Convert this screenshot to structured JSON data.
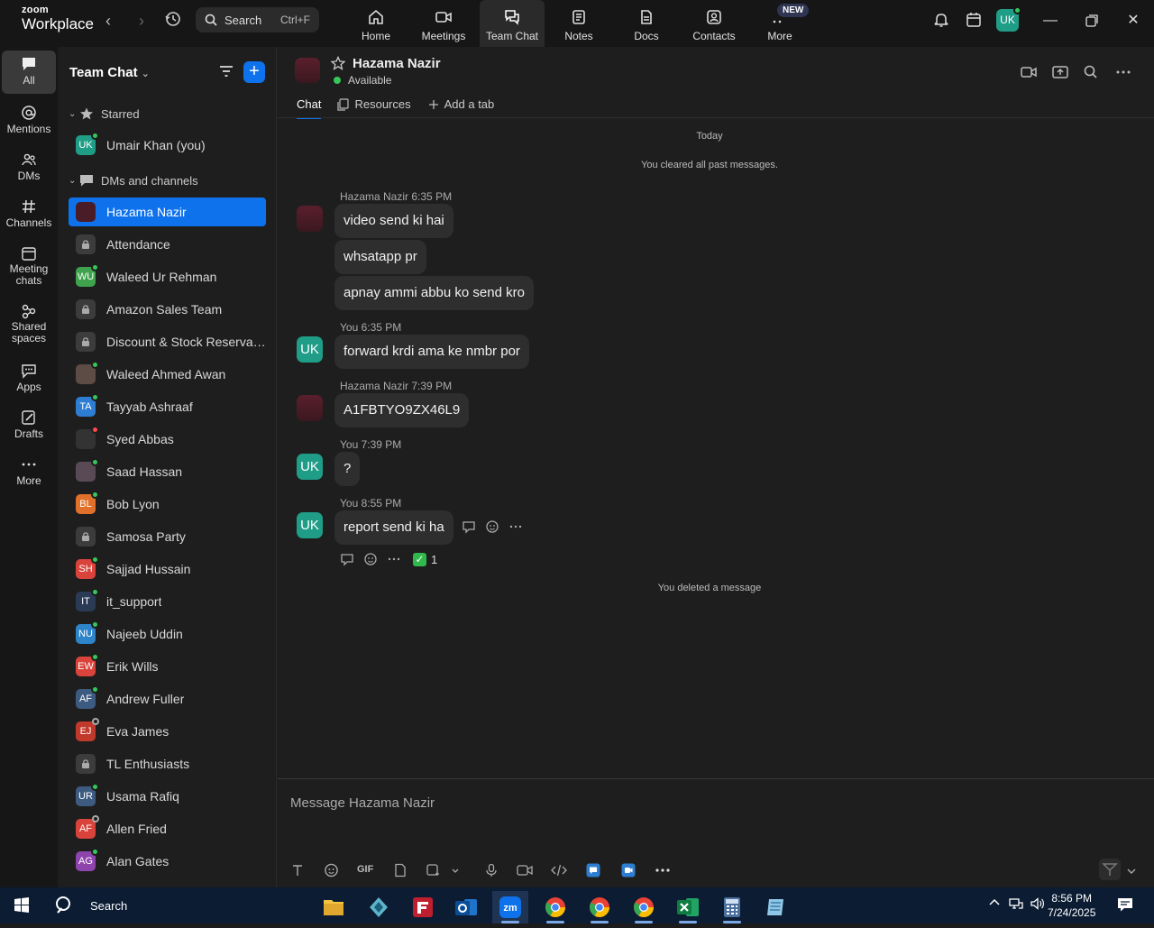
{
  "app": {
    "logo_line1": "zoom",
    "logo_line2": "Workplace",
    "search_label": "Search",
    "search_shortcut": "Ctrl+F",
    "nav": [
      {
        "label": "Home"
      },
      {
        "label": "Meetings"
      },
      {
        "label": "Team Chat"
      },
      {
        "label": "Notes"
      },
      {
        "label": "Docs"
      },
      {
        "label": "Contacts"
      },
      {
        "label": "More"
      }
    ],
    "new_badge": "NEW",
    "user_initials": "UK",
    "accent_color": "#0e72ed"
  },
  "rail": [
    {
      "label": "All"
    },
    {
      "label": "Mentions"
    },
    {
      "label": "DMs"
    },
    {
      "label": "Channels"
    },
    {
      "label": "Meeting chats"
    },
    {
      "label": "Shared spaces"
    },
    {
      "label": "Apps"
    },
    {
      "label": "Drafts"
    },
    {
      "label": "More"
    }
  ],
  "sidebar": {
    "title": "Team Chat",
    "starred_label": "Starred",
    "dms_label": "DMs and channels",
    "starred": [
      {
        "initials": "UK",
        "name": "Umair Khan (you)",
        "color": "#1f9d86",
        "status": "on"
      }
    ],
    "items": [
      {
        "initials": "",
        "name": "Hazama Nazir",
        "color": "#4a1c28",
        "status": "",
        "selected": true
      },
      {
        "initials": "",
        "name": "Attendance",
        "lock": true
      },
      {
        "initials": "WU",
        "name": "Waleed Ur Rehman",
        "color": "#3fa34d",
        "status": "on"
      },
      {
        "initials": "",
        "name": "Amazon Sales Team",
        "lock": true
      },
      {
        "initials": "",
        "name": "Discount & Stock Reservati...",
        "lock": true
      },
      {
        "initials": "",
        "name": "Waleed Ahmed Awan",
        "color": "#5d4b45",
        "status": "on"
      },
      {
        "initials": "TA",
        "name": "Tayyab Ashraaf",
        "color": "#2d7dd2",
        "status": "on"
      },
      {
        "initials": "",
        "name": "Syed Abbas",
        "color": "#333333",
        "status": "busy"
      },
      {
        "initials": "",
        "name": "Saad Hassan",
        "color": "#5a4a55",
        "status": "on"
      },
      {
        "initials": "BL",
        "name": "Bob Lyon",
        "color": "#e0702a",
        "status": "on"
      },
      {
        "initials": "",
        "name": "Samosa Party",
        "lock": true
      },
      {
        "initials": "SH",
        "name": "Sajjad Hussain",
        "color": "#d9433b",
        "status": "on"
      },
      {
        "initials": "IT",
        "name": "it_support",
        "color": "#2b3a55",
        "status": "on"
      },
      {
        "initials": "NU",
        "name": "Najeeb Uddin",
        "color": "#2d84c8",
        "status": "on"
      },
      {
        "initials": "EW",
        "name": "Erik Wills",
        "color": "#d9433b",
        "status": "on"
      },
      {
        "initials": "AF",
        "name": "Andrew Fuller",
        "color": "#3d5a80",
        "status": "on"
      },
      {
        "initials": "EJ",
        "name": "Eva James",
        "color": "#c0392b",
        "status": "off"
      },
      {
        "initials": "",
        "name": "TL Enthusiasts",
        "lock": true
      },
      {
        "initials": "UR",
        "name": "Usama Rafiq",
        "color": "#3d5a80",
        "status": "on"
      },
      {
        "initials": "AF",
        "name": "Allen Fried",
        "color": "#d9433b",
        "status": "off"
      },
      {
        "initials": "AG",
        "name": "Alan Gates",
        "color": "#8e44ad",
        "status": "on"
      }
    ]
  },
  "chat": {
    "contact_name": "Hazama Nazir",
    "contact_status": "Available",
    "tabs": [
      {
        "label": "Chat"
      },
      {
        "label": "Resources"
      },
      {
        "label": "Add a tab"
      }
    ],
    "date_label": "Today",
    "cleared_note": "You cleared all past messages.",
    "deleted_note": "You deleted a message",
    "groups": [
      {
        "sender": "Hazama Nazir",
        "time": "6:35 PM",
        "avatar": "hz",
        "messages": [
          "video send ki hai",
          "whsatapp pr",
          "apnay ammi abbu ko send kro"
        ]
      },
      {
        "sender": "You",
        "time": "6:35 PM",
        "avatar": "uk",
        "initials": "UK",
        "messages": [
          "forward krdi ama ke nmbr por"
        ]
      },
      {
        "sender": "Hazama Nazir",
        "time": "7:39 PM",
        "avatar": "hz",
        "messages": [
          "A1FBTYO9ZX46L9"
        ]
      },
      {
        "sender": "You",
        "time": "7:39 PM",
        "avatar": "uk",
        "initials": "UK",
        "messages": [
          "?"
        ]
      },
      {
        "sender": "You",
        "time": "8:55 PM",
        "avatar": "uk",
        "initials": "UK",
        "messages": [
          "report send ki ha"
        ]
      }
    ],
    "reaction_count": "1",
    "composer_placeholder": "Message Hazama Nazir",
    "gif_label": "GIF"
  },
  "taskbar": {
    "search_label": "Search",
    "time": "8:56 PM",
    "date": "7/24/2025"
  }
}
